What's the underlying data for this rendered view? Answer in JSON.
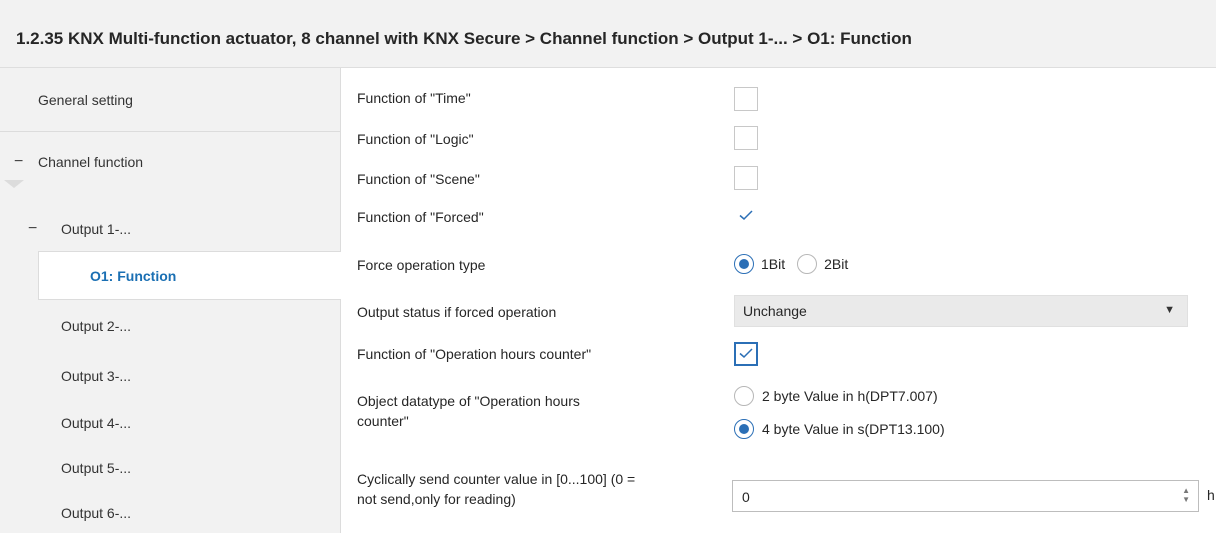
{
  "header": {
    "breadcrumb": "1.2.35 KNX Multi-function actuator, 8 channel with KNX Secure > Channel function > Output 1-... > O1: Function"
  },
  "sidebar": {
    "items": [
      {
        "label": "General setting",
        "collapse": ""
      },
      {
        "label": "Channel function",
        "collapse": "−"
      },
      {
        "label": "Output 1-...",
        "collapse": "−"
      },
      {
        "label": "O1: Function",
        "collapse": ""
      },
      {
        "label": "Output 2-...",
        "collapse": ""
      },
      {
        "label": "Output 3-...",
        "collapse": ""
      },
      {
        "label": "Output 4-...",
        "collapse": ""
      },
      {
        "label": "Output 5-...",
        "collapse": ""
      },
      {
        "label": "Output 6-...",
        "collapse": ""
      }
    ],
    "selected_index": 3
  },
  "params": {
    "time_label": "Function of \"Time\"",
    "time_checked": false,
    "logic_label": "Function of \"Logic\"",
    "logic_checked": false,
    "scene_label": "Function of \"Scene\"",
    "scene_checked": false,
    "forced_label": "Function of \"Forced\"",
    "forced_checked": true,
    "force_type_label": "Force operation type",
    "force_type_options": [
      "1Bit",
      "2Bit"
    ],
    "force_type_selected": "1Bit",
    "output_status_label": "Output status if forced operation",
    "output_status_value": "Unchange",
    "hours_counter_label": "Function of \"Operation hours counter\"",
    "hours_counter_checked": true,
    "datatype_label_line1": "Object datatype of \"Operation hours",
    "datatype_label_line2": "counter\"",
    "datatype_options": [
      "2 byte Value in h(DPT7.007)",
      "4 byte Value in s(DPT13.100)"
    ],
    "datatype_selected": "4 byte Value in s(DPT13.100)",
    "cyclic_label_line1": "Cyclically send counter value in [0...100] (0 =",
    "cyclic_label_line2": "not send,only for reading)",
    "cyclic_value": "0",
    "cyclic_unit": "h"
  },
  "colors": {
    "accent": "#2b6fb6",
    "selected_text": "#1a6fb3",
    "sidebar_bg": "#f2f2f2"
  }
}
